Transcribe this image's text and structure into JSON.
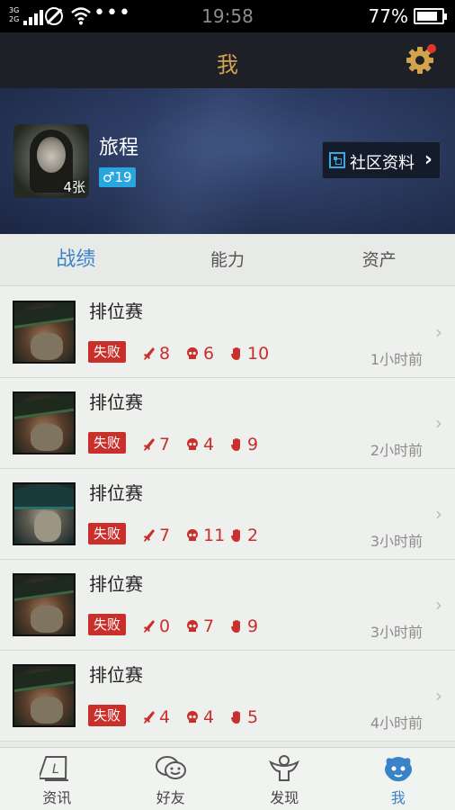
{
  "status_bar": {
    "network": "3G\n2G",
    "time": "19:58",
    "battery": "77%"
  },
  "header": {
    "title": "我"
  },
  "profile": {
    "name": "旅程",
    "photo_count": "4张",
    "gender_level": "♂19",
    "community_label": "社区资料",
    "community_chevron": "›"
  },
  "tabs": [
    {
      "label": "战绩"
    },
    {
      "label": "能力"
    },
    {
      "label": "资产"
    }
  ],
  "matches": [
    {
      "mode": "排位赛",
      "result": "失败",
      "kills": "8",
      "deaths": "6",
      "assists": "10",
      "time": "1小时前",
      "champion": "green-hat"
    },
    {
      "mode": "排位赛",
      "result": "失败",
      "kills": "7",
      "deaths": "4",
      "assists": "9",
      "time": "2小时前",
      "champion": "green-hat"
    },
    {
      "mode": "排位赛",
      "result": "失败",
      "kills": "7",
      "deaths": "11",
      "assists": "2",
      "time": "3小时前",
      "champion": "teal-hood"
    },
    {
      "mode": "排位赛",
      "result": "失败",
      "kills": "0",
      "deaths": "7",
      "assists": "9",
      "time": "3小时前",
      "champion": "green-hat"
    },
    {
      "mode": "排位赛",
      "result": "失败",
      "kills": "4",
      "deaths": "4",
      "assists": "5",
      "time": "4小时前",
      "champion": "green-hat"
    }
  ],
  "nav": [
    {
      "label": "资讯",
      "icon": "news-icon"
    },
    {
      "label": "好友",
      "icon": "friends-icon"
    },
    {
      "label": "发现",
      "icon": "discover-icon"
    },
    {
      "label": "我",
      "icon": "me-icon"
    }
  ],
  "colors": {
    "accent": "#3a83c8",
    "loss": "#c9302c",
    "header_title": "#d2a34a"
  }
}
